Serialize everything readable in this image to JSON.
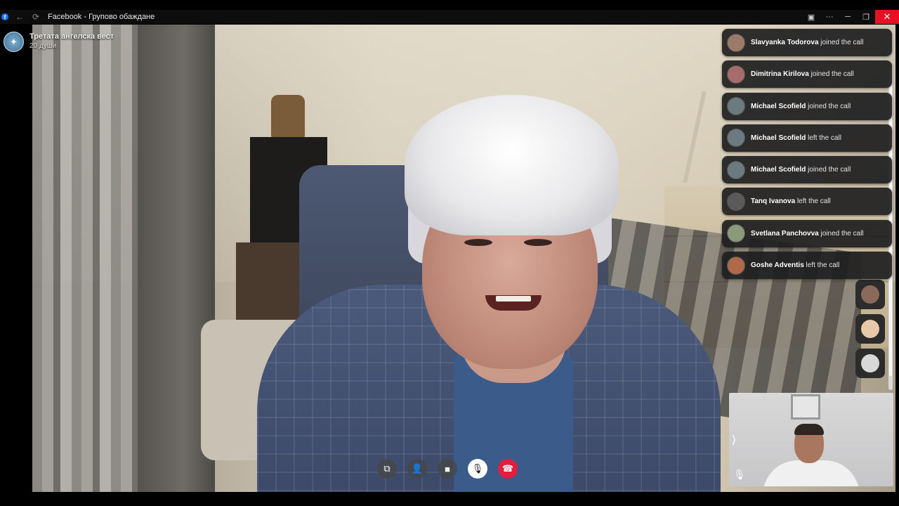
{
  "window": {
    "title": "Facebook - Групово обаждане",
    "fb_glyph": "f",
    "back_glyph": "←",
    "reload_glyph": "⟳",
    "icons": [
      "camera-window-icon",
      "more-icon",
      "minimize-icon",
      "restore-icon",
      "close-icon"
    ],
    "icon_glyphs": {
      "camera": "▣",
      "more": "···",
      "minimize": "─",
      "restore": "❐",
      "close": "✕"
    },
    "close_color": "#e81123"
  },
  "group": {
    "name": "Третата ангелска вест",
    "members": "20 души"
  },
  "notifications": [
    {
      "name": "Slavyanka Todorova",
      "action": "joined the call",
      "avatar_color": "#9c7a6a"
    },
    {
      "name": "Dimitrina Kirilova",
      "action": "joined the call",
      "avatar_color": "#a86a6a"
    },
    {
      "name": "Michael Scofield",
      "action": "joined the call",
      "avatar_color": "#6b7a80"
    },
    {
      "name": "Michael Scofield",
      "action": "left the call",
      "avatar_color": "#6b7a80"
    },
    {
      "name": "Michael Scofield",
      "action": "joined the call",
      "avatar_color": "#6b7a80"
    },
    {
      "name": "Tanq Ivanova",
      "action": "left the call",
      "avatar_color": "#5a5a5a"
    },
    {
      "name": "Svetlana Panchovva",
      "action": "joined the call",
      "avatar_color": "#8a9a7a"
    },
    {
      "name": "Goshe Adventis",
      "action": "left the call",
      "avatar_color": "#b06a4a"
    }
  ],
  "participants_strip": [
    {
      "avatar_color": "#8a6a5a"
    },
    {
      "avatar_color": "#e8c8a8"
    },
    {
      "avatar_color": "#d8d8d8"
    }
  ],
  "self_view": {
    "expand_glyph": "⟩",
    "mute_glyph": "🎙"
  },
  "controls": [
    {
      "name": "share-screen-button",
      "glyph": "⧉",
      "style": "dark"
    },
    {
      "name": "add-people-button",
      "glyph": "👤",
      "style": "dark"
    },
    {
      "name": "camera-button",
      "glyph": "■",
      "style": "dark"
    },
    {
      "name": "mute-button",
      "glyph": "🎙",
      "style": "white"
    },
    {
      "name": "end-call-button",
      "glyph": "☎",
      "style": "red"
    }
  ],
  "colors": {
    "accent": "#1877f2",
    "end_call": "#e41e3f"
  }
}
